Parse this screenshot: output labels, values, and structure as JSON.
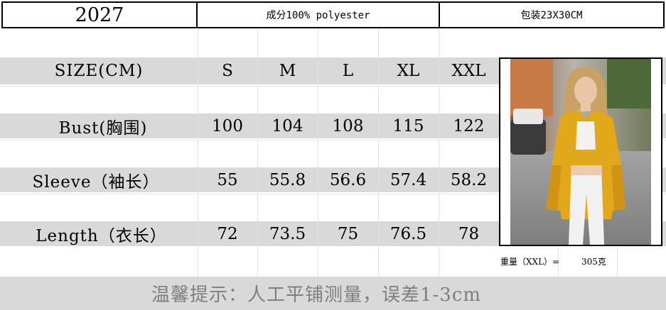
{
  "header": {
    "code": "2027",
    "material": "成分100% polyester",
    "package": "包装23X30CM"
  },
  "table": {
    "size_label": "SIZE(CM)",
    "sizes": [
      "S",
      "M",
      "L",
      "XL",
      "XXL"
    ],
    "rows": [
      {
        "label": "Bust(胸围)",
        "values": [
          "100",
          "104",
          "108",
          "115",
          "122"
        ]
      },
      {
        "label": "Sleeve（袖长）",
        "values": [
          "55",
          "55.8",
          "56.6",
          "57.4",
          "58.2"
        ]
      },
      {
        "label": "Length（衣长）",
        "values": [
          "72",
          "73.5",
          "75",
          "76.5",
          "78"
        ]
      }
    ]
  },
  "weight": {
    "label": "重量（XXL）=",
    "value": "305克"
  },
  "footer": {
    "note": "温馨提示：人工平铺测量，误差1-3cm"
  },
  "photo": {
    "subject": "model-in-yellow-shirt"
  }
}
